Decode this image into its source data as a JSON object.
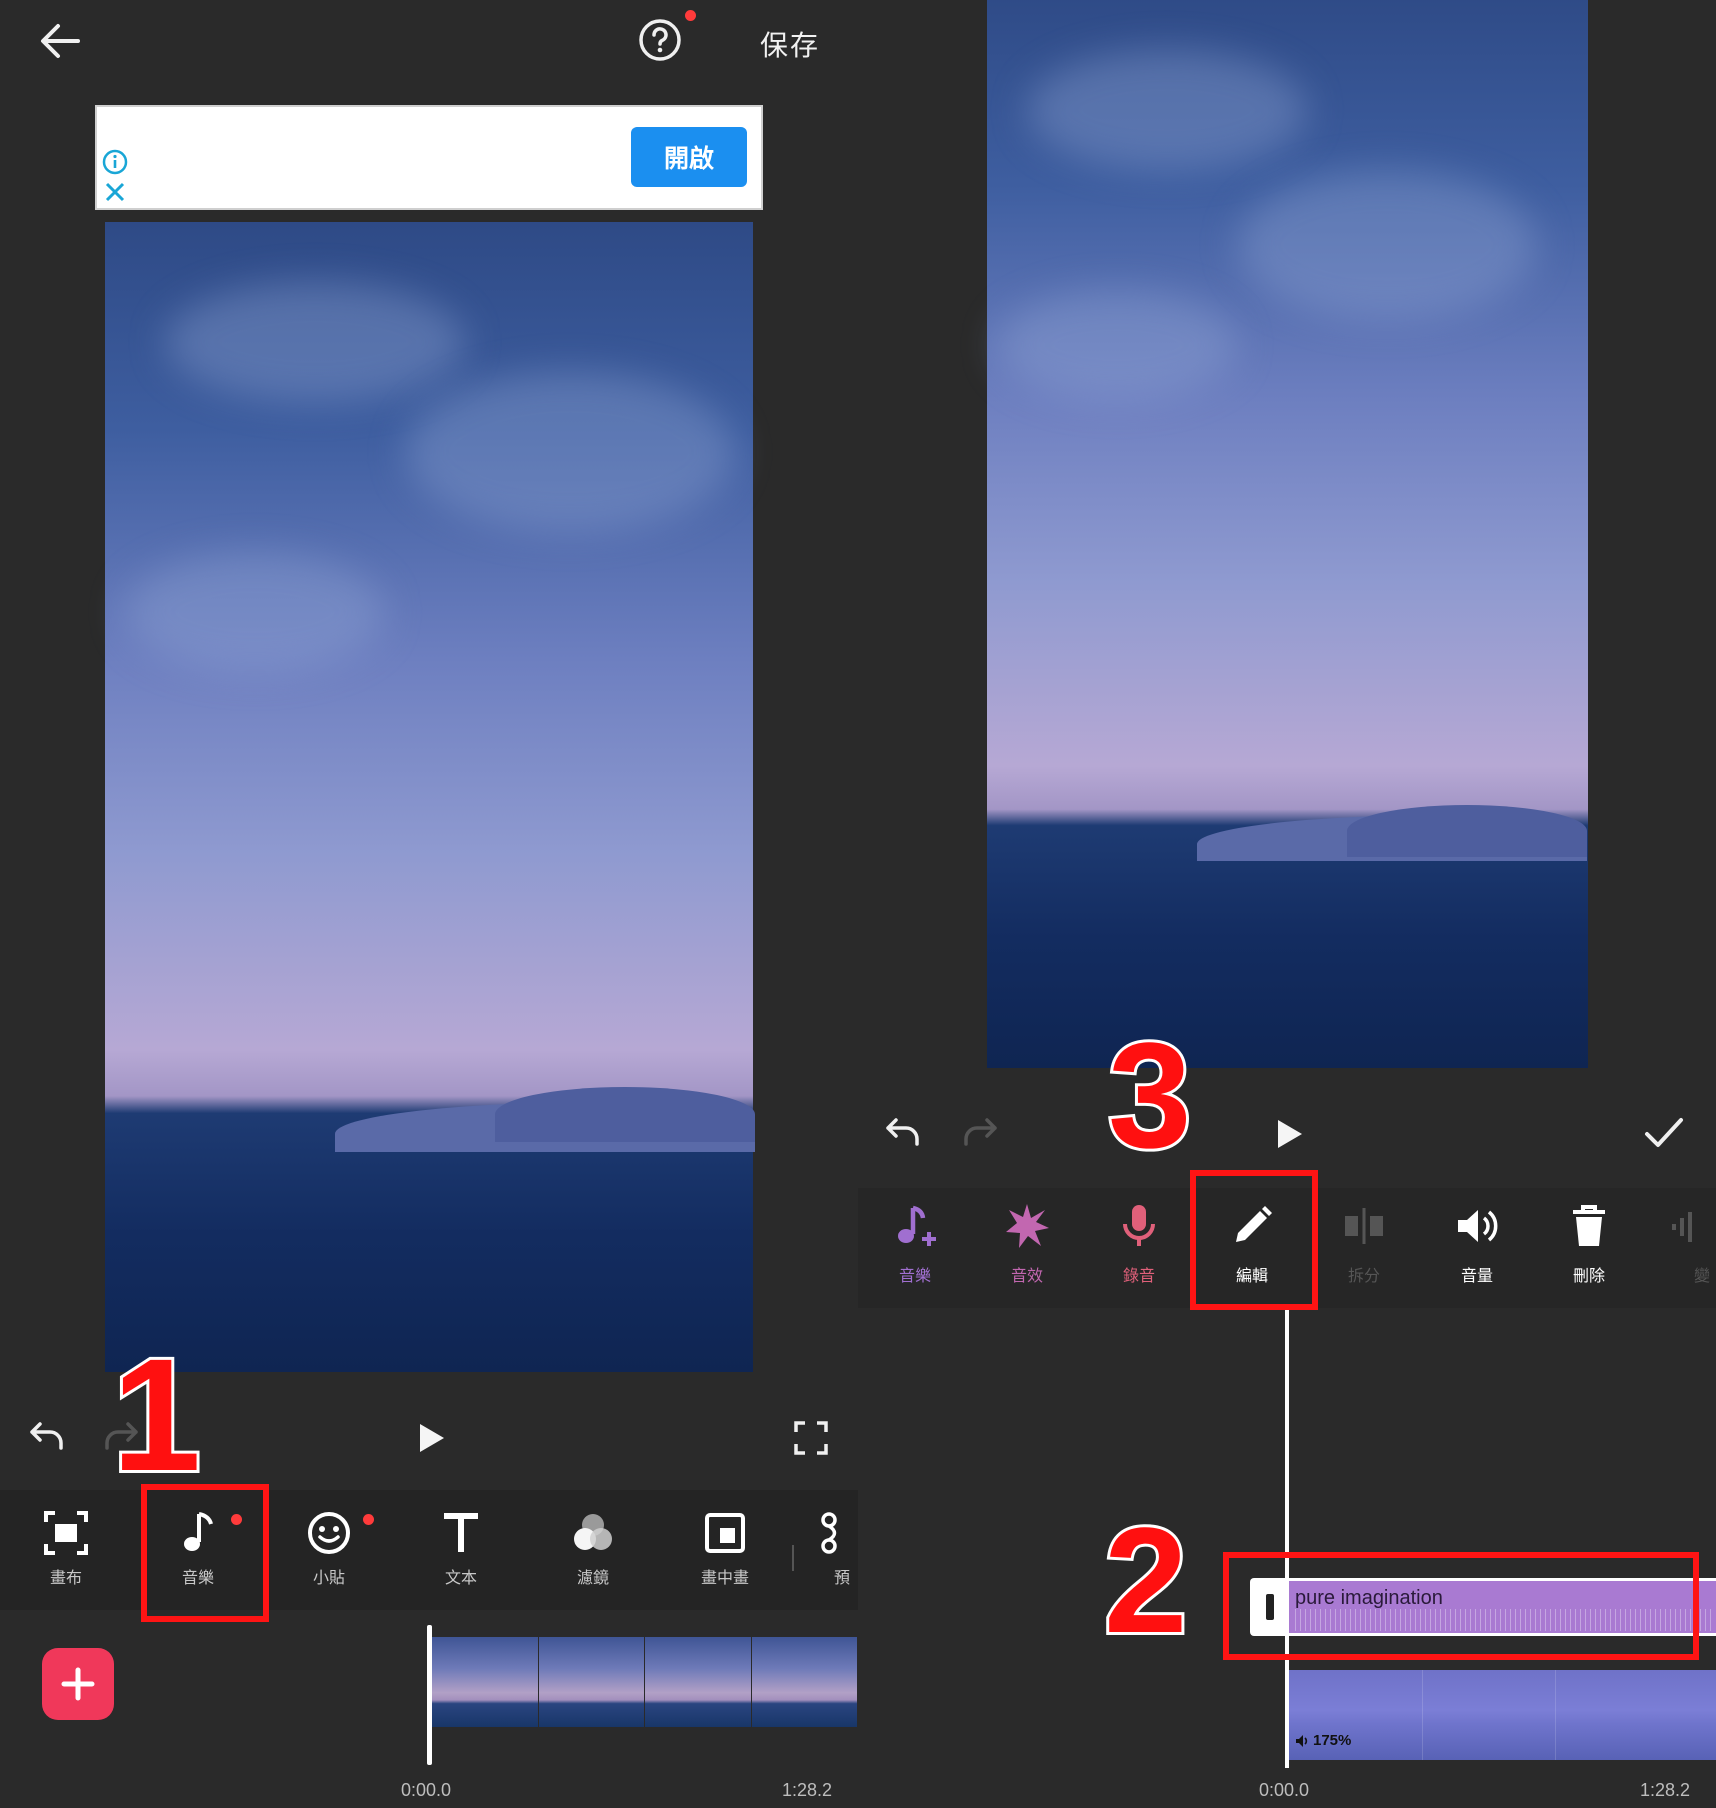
{
  "header": {
    "save_label": "保存"
  },
  "ad": {
    "open_label": "開啟"
  },
  "left_toolbar": {
    "items": [
      {
        "label": "畫布",
        "icon": "canvas-icon"
      },
      {
        "label": "音樂",
        "icon": "music-note-icon"
      },
      {
        "label": "小貼",
        "icon": "sticker-icon"
      },
      {
        "label": "文本",
        "icon": "text-icon"
      },
      {
        "label": "濾鏡",
        "icon": "filter-icon"
      },
      {
        "label": "畫中畫",
        "icon": "pip-icon"
      },
      {
        "label": "預",
        "icon": "preset-icon"
      }
    ]
  },
  "left_timeline": {
    "start_time": "0:00.0",
    "end_time": "1:28.2"
  },
  "right_toolbar": {
    "items": [
      {
        "label": "音樂",
        "icon": "add-music-icon",
        "color": "#a06fd0"
      },
      {
        "label": "音效",
        "icon": "sound-effect-icon",
        "color": "#c267b0"
      },
      {
        "label": "錄音",
        "icon": "microphone-icon",
        "color": "#e0607a"
      },
      {
        "label": "編輯",
        "icon": "pencil-icon",
        "color": "#ffffff"
      },
      {
        "label": "拆分",
        "icon": "split-icon",
        "color": "#555555"
      },
      {
        "label": "音量",
        "icon": "volume-icon",
        "color": "#ffffff"
      },
      {
        "label": "刪除",
        "icon": "trash-icon",
        "color": "#ffffff"
      },
      {
        "label": "變",
        "icon": "fade-icon",
        "color": "#555555"
      }
    ]
  },
  "right_timeline": {
    "music_clip_title": "pure imagination",
    "video_volume": "175%",
    "start_time": "0:00.0",
    "end_time": "1:28.2"
  },
  "annotations": {
    "step1": "1",
    "step2": "2",
    "step3": "3"
  },
  "colors": {
    "accent_red": "#ff1414",
    "ad_button": "#1b8ff0",
    "add_button": "#f0385a",
    "music_clip": "#a97ad2"
  }
}
